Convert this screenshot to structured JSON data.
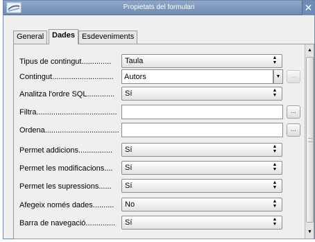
{
  "window": {
    "title": "Propietats del formulari",
    "close_glyph": "✕",
    "app_icon": "form-properties-icon"
  },
  "tabs": [
    {
      "label": "General",
      "active": false
    },
    {
      "label": "Dades",
      "active": true
    },
    {
      "label": "Esdeveniments",
      "active": false
    }
  ],
  "fields": [
    {
      "label": "Tipus de contingut..............",
      "value": "Taula",
      "control": "listbox"
    },
    {
      "label": "Contingut.............................",
      "value": "Autors",
      "control": "combobox"
    },
    {
      "label": "Analitza l'ordre SQL.............",
      "value": "Sí",
      "control": "listbox"
    },
    {
      "label": "Filtra......................................",
      "value": "",
      "control": "textfield"
    },
    {
      "label": "Ordena...................................",
      "value": "",
      "control": "textfield"
    },
    {
      "label": "Permet addicions................",
      "value": "Sí",
      "control": "listbox"
    },
    {
      "label": "Permet les modificacions....",
      "value": "Sí",
      "control": "listbox"
    },
    {
      "label": "Permet les supressions......",
      "value": "Sí",
      "control": "listbox"
    },
    {
      "label": "Afegeix només dades..........",
      "value": "No",
      "control": "listbox"
    },
    {
      "label": "Barra de navegació..............",
      "value": "Sí",
      "control": "listbox"
    }
  ],
  "ellipsis_label": "...",
  "glyphs": {
    "spin": "▲\n▼",
    "dropdown": "▼",
    "scroll_up": "▲",
    "scroll_down": "▼"
  }
}
